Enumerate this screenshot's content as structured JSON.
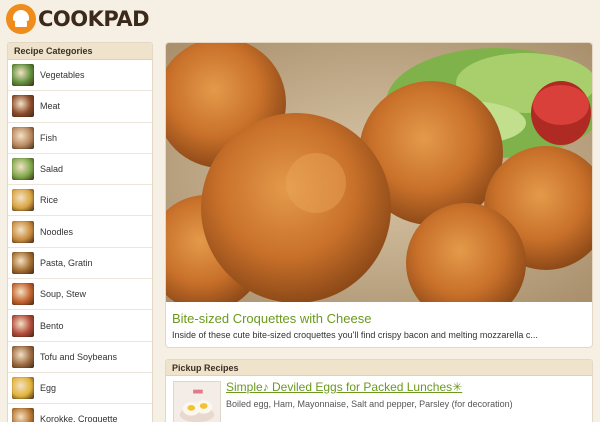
{
  "header": {
    "logo_text": "COOKPAD"
  },
  "sidebar": {
    "title": "Recipe Categories",
    "items": [
      {
        "label": "Vegetables",
        "icon": "vegetables-thumbnail",
        "color": "#5f8f3a"
      },
      {
        "label": "Meat",
        "icon": "meat-thumbnail",
        "color": "#8b4a2b"
      },
      {
        "label": "Fish",
        "icon": "fish-thumbnail",
        "color": "#b8875e"
      },
      {
        "label": "Salad",
        "icon": "salad-thumbnail",
        "color": "#7fa84a"
      },
      {
        "label": "Rice",
        "icon": "rice-thumbnail",
        "color": "#d9a441"
      },
      {
        "label": "Noodles",
        "icon": "noodles-thumbnail",
        "color": "#c98a3c"
      },
      {
        "label": "Pasta, Gratin",
        "icon": "pasta-thumbnail",
        "color": "#a36b2e"
      },
      {
        "label": "Soup, Stew",
        "icon": "soup-thumbnail",
        "color": "#c4612c"
      },
      {
        "label": "Bento",
        "icon": "bento-thumbnail",
        "color": "#b24a3a"
      },
      {
        "label": "Tofu and Soybeans",
        "icon": "tofu-thumbnail",
        "color": "#9c6a3f"
      },
      {
        "label": "Egg",
        "icon": "egg-thumbnail",
        "color": "#e2b23a"
      },
      {
        "label": "Korokke, Croquette",
        "icon": "croquette-thumbnail",
        "color": "#b7742f"
      }
    ]
  },
  "feature": {
    "title": "Bite-sized Croquettes with Cheese",
    "description": "Inside of these cute bite-sized croquettes you'll find crispy bacon and melting mozzarella c..."
  },
  "pickup": {
    "title": "Pickup Recipes",
    "recipe_title": "Simple♪ Deviled Eggs for Packed Lunches✳",
    "ingredients": "Boiled egg, Ham, Mayonnaise, Salt and pepper, Parsley (for decoration)"
  },
  "colors": {
    "background": "#f6efe3",
    "accent_green": "#6b9a1e",
    "logo_orange": "#f08c1b",
    "panel_header": "#efe3cc"
  }
}
